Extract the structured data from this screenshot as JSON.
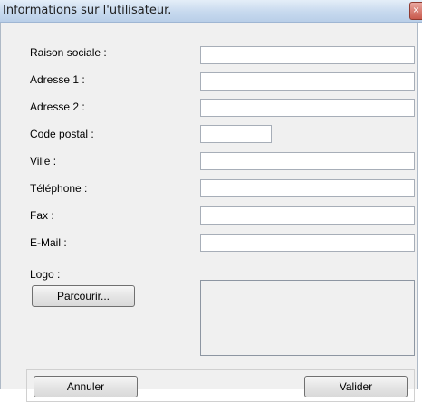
{
  "window": {
    "title": "Informations sur l'utilisateur.",
    "close_glyph": "×"
  },
  "form": {
    "fields": [
      {
        "label": "Raison sociale :",
        "value": ""
      },
      {
        "label": "Adresse 1 :",
        "value": ""
      },
      {
        "label": "Adresse 2 :",
        "value": ""
      },
      {
        "label": "Code postal :",
        "value": ""
      },
      {
        "label": "Ville :",
        "value": ""
      },
      {
        "label": "Téléphone :",
        "value": ""
      },
      {
        "label": "Fax :",
        "value": ""
      },
      {
        "label": "E-Mail :",
        "value": ""
      }
    ],
    "logo_label": "Logo :",
    "browse_label": "Parcourir..."
  },
  "footer": {
    "cancel_label": "Annuler",
    "ok_label": "Valider"
  },
  "icons": {
    "close": "close-icon"
  },
  "colors": {
    "titlebar": "#c7d9ee",
    "dialog_bg": "#f0f0f0",
    "close_button": "#c95a4d"
  }
}
